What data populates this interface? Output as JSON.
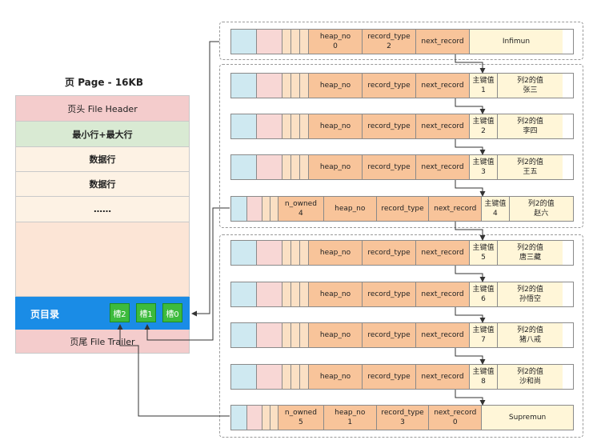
{
  "page": {
    "title": "页 Page - 16KB",
    "file_header": "页头 File Header",
    "min_max": "最小行+最大行",
    "data_row_1": "数据行",
    "data_row_2": "数据行",
    "ellipsis": "……",
    "directory": "页目录",
    "slots": [
      "槽2",
      "槽1",
      "槽0"
    ],
    "file_trailer": "页尾 File Trailer"
  },
  "colors": {
    "file_header": "#f4cccc",
    "min_max": "#d9ead3",
    "data_row": "#fdf2e4",
    "free": "#fce5d6",
    "directory": "#1a8ce6",
    "slot": "#3dbb3d",
    "record_blue": "#cfe9f1",
    "record_pink": "#f8d7d5",
    "record_orange": "#f8c49a",
    "record_value": "#fff6d8"
  },
  "labels": {
    "heap_no": "heap_no",
    "record_type": "record_type",
    "next_record": "next_record",
    "n_owned": "n_owned",
    "key": "主键值",
    "col2": "列2的值"
  },
  "infimum": {
    "heap_no": "0",
    "record_type": "2",
    "label": "Infimun"
  },
  "supremum": {
    "n_owned": "5",
    "heap_no": "1",
    "record_type": "3",
    "next_record": "0",
    "label": "Supremun"
  },
  "records": [
    {
      "key": "1",
      "val": "张三"
    },
    {
      "key": "2",
      "val": "李四"
    },
    {
      "key": "3",
      "val": "王五"
    },
    {
      "key": "4",
      "val": "赵六",
      "n_owned": "4"
    },
    {
      "key": "5",
      "val": "唐三藏"
    },
    {
      "key": "6",
      "val": "孙悟空"
    },
    {
      "key": "7",
      "val": "猪八戒"
    },
    {
      "key": "8",
      "val": "沙和尚"
    }
  ]
}
